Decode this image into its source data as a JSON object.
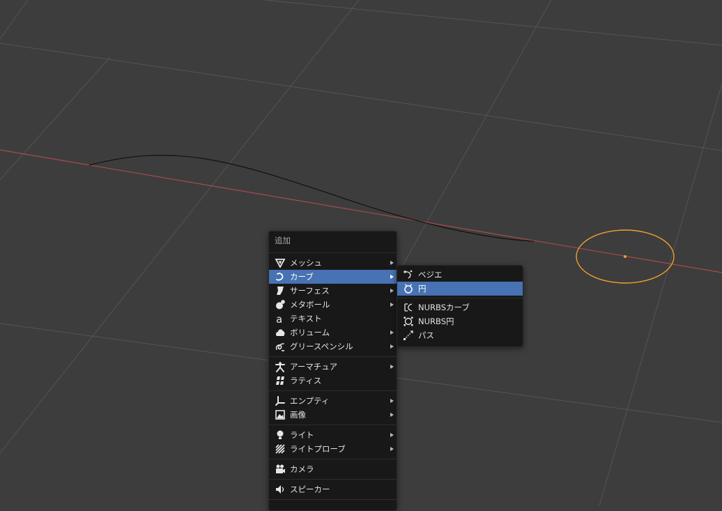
{
  "add_menu": {
    "title": "追加",
    "items": [
      {
        "label": "メッシュ",
        "icon": "mesh-icon",
        "submenu": true
      },
      {
        "label": "カーブ",
        "icon": "curve-icon",
        "submenu": true,
        "active": true
      },
      {
        "label": "サーフェス",
        "icon": "surface-icon",
        "submenu": true
      },
      {
        "label": "メタボール",
        "icon": "metaball-icon",
        "submenu": true
      },
      {
        "label": "テキスト",
        "icon": "text-icon",
        "submenu": false
      },
      {
        "label": "ボリューム",
        "icon": "volume-icon",
        "submenu": true
      },
      {
        "label": "グリースペンシル",
        "icon": "grease-pencil-icon",
        "submenu": true
      },
      {
        "label": "アーマチュア",
        "icon": "armature-icon",
        "submenu": true
      },
      {
        "label": "ラティス",
        "icon": "lattice-icon",
        "submenu": false
      },
      {
        "label": "エンプティ",
        "icon": "empty-icon",
        "submenu": true
      },
      {
        "label": "画像",
        "icon": "image-icon",
        "submenu": true
      },
      {
        "label": "ライト",
        "icon": "light-icon",
        "submenu": true
      },
      {
        "label": "ライトプローブ",
        "icon": "light-probe-icon",
        "submenu": true
      },
      {
        "label": "カメラ",
        "icon": "camera-icon",
        "submenu": false
      },
      {
        "label": "スピーカー",
        "icon": "speaker-icon",
        "submenu": false
      }
    ]
  },
  "curve_submenu": {
    "items": [
      {
        "label": "ベジエ",
        "icon": "bezier-icon"
      },
      {
        "label": "円",
        "icon": "circle-icon",
        "active": true
      },
      {
        "label": "NURBSカーブ",
        "icon": "nurbs-curve-icon"
      },
      {
        "label": "NURBS円",
        "icon": "nurbs-circle-icon"
      },
      {
        "label": "パス",
        "icon": "path-icon"
      }
    ]
  },
  "colors": {
    "viewport_bg": "#3d3d3d",
    "grid_line": "#545454",
    "x_axis": "#a94a4e",
    "selected_outline": "#f0a030",
    "menu_bg": "#181818",
    "menu_highlight": "#4772b3"
  }
}
